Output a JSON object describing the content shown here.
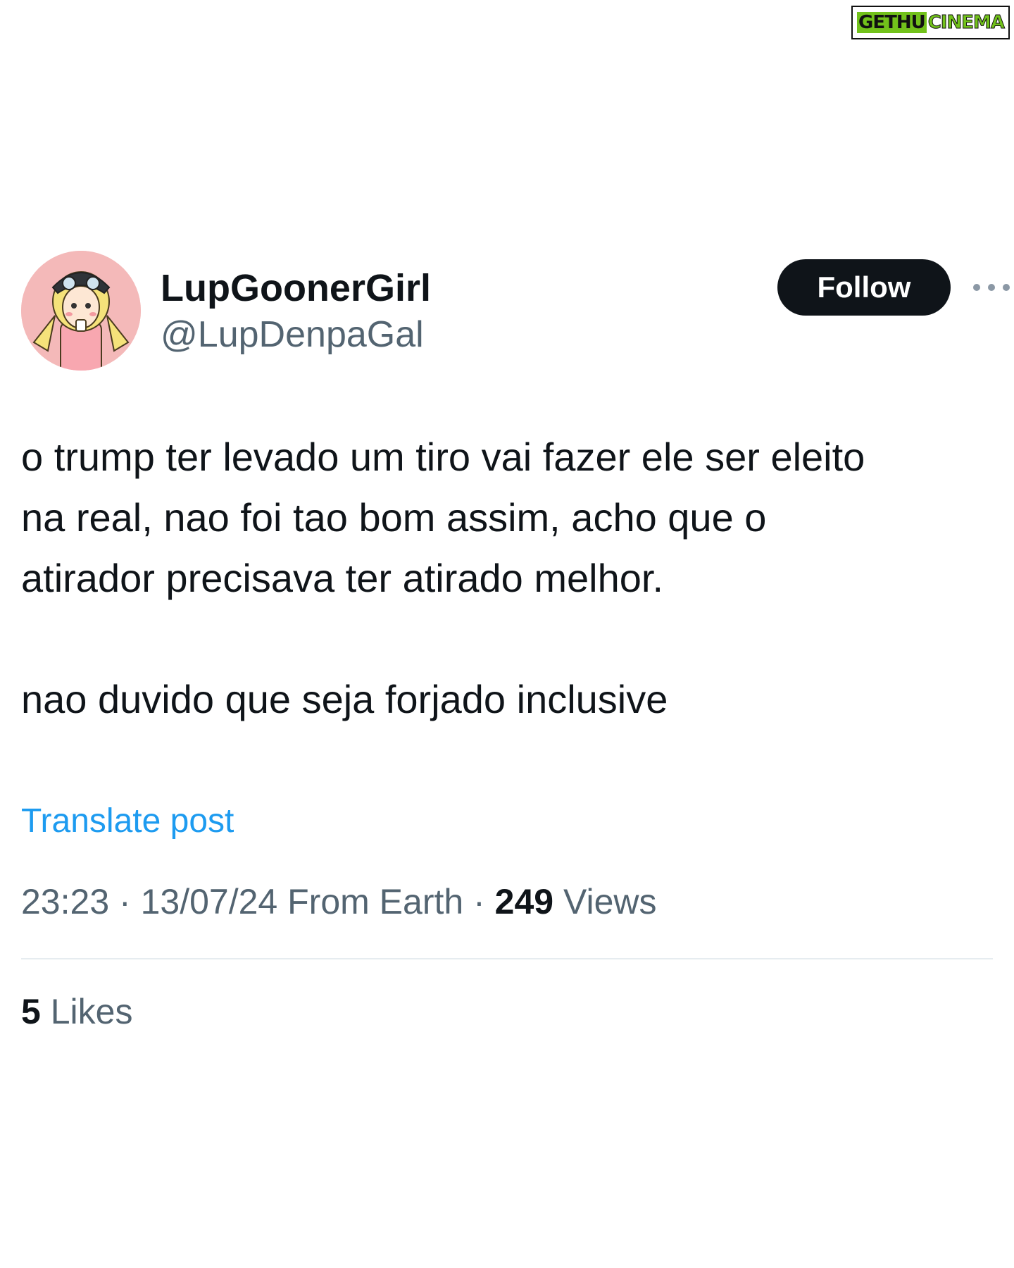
{
  "watermark": {
    "left_text": "GETHU",
    "right_text": "CINEMA"
  },
  "tweet": {
    "author": {
      "display_name": "LupGoonerGirl",
      "handle": "@LupDenpaGal",
      "avatar_icon": "anime-girl-avatar-icon"
    },
    "follow_label": "Follow",
    "more_icon": "more-horizontal-icon",
    "text_lines": [
      "o trump ter levado um tiro vai fazer ele ser eleito",
      "na real, nao foi tao bom assim, acho que o",
      "atirador precisava ter atirado melhor.",
      "nao duvido que seja forjado inclusive"
    ],
    "translate_label": "Translate post",
    "meta": {
      "time": "23:23",
      "separator": "·",
      "date": "13/07/24",
      "source": "From Earth",
      "views_count": "249",
      "views_label": "Views"
    },
    "likes": {
      "count": "5",
      "label": "Likes"
    }
  },
  "colors": {
    "text_primary": "#0f1419",
    "text_secondary": "#536471",
    "link": "#1d9bf0",
    "follow_bg": "#0f1419",
    "follow_fg": "#ffffff",
    "watermark_green": "#72c21b"
  }
}
